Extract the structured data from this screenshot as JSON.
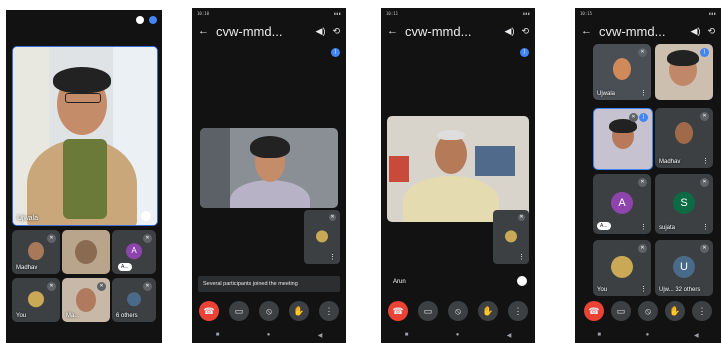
{
  "screens": [
    {
      "main_speaker": "Ujwala",
      "tiles": [
        {
          "name": "Madhav"
        },
        {
          "name": ""
        },
        {
          "initial": "A",
          "name": "A..."
        },
        {
          "name": "You"
        },
        {
          "name": "Ma..."
        },
        {
          "name": "6 others"
        }
      ]
    },
    {
      "title": "cvw-mmd...",
      "toast": "Several participants joined the meeting"
    },
    {
      "title": "cvw-mmd...",
      "main_speaker": "Arun"
    },
    {
      "title": "cvw-mmd...",
      "tiles": [
        {
          "name": "Ujwala"
        },
        {
          "name": ""
        },
        {
          "name": ""
        },
        {
          "name": "Madhav"
        },
        {
          "initial": "A",
          "name": "A..."
        },
        {
          "initial": "S",
          "name": "sujata"
        },
        {
          "name": "You"
        },
        {
          "initial": "U",
          "name": "Ujw... 32 others"
        }
      ]
    }
  ],
  "colors": {
    "background": "#121212",
    "tile": "#3c4043",
    "end_call": "#ea4335",
    "accent_blue": "#4285f4",
    "avatar_purple": "#8e44ad",
    "avatar_green": "#0b6b45",
    "avatar_slate": "#4a6a8a"
  },
  "icons": [
    "back-arrow-icon",
    "speaker-icon",
    "switch-camera-icon",
    "end-call-icon",
    "camera-off-icon",
    "mic-off-icon",
    "raise-hand-icon",
    "more-icon",
    "mic-muted-icon",
    "kebab-icon"
  ]
}
